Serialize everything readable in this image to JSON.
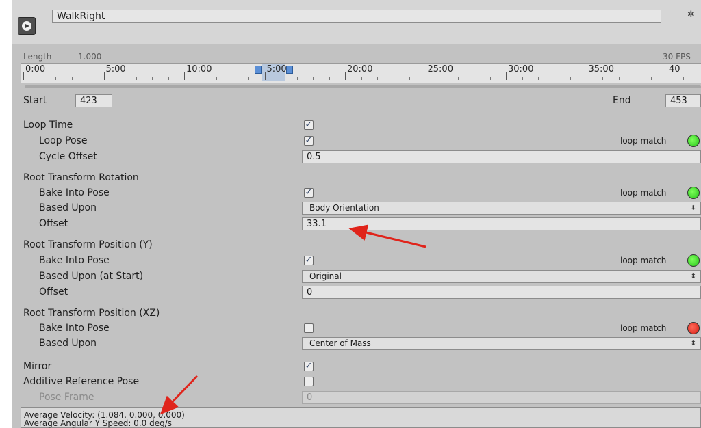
{
  "header": {
    "clip_name": "WalkRight",
    "play_icon": "play-icon",
    "settings_icon": "gear-icon"
  },
  "timeline": {
    "length_label": "Length",
    "length_value": "1.000",
    "fps": "30 FPS",
    "ticks": [
      "0:00",
      "5:00",
      "10:00",
      "5:00",
      "20:00",
      "25:00",
      "30:00",
      "35:00",
      "40"
    ]
  },
  "range": {
    "start_label": "Start",
    "start_value": "423",
    "end_label": "End",
    "end_value": "453"
  },
  "loop_time": {
    "label": "Loop Time",
    "checked": true,
    "loop_pose_label": "Loop Pose",
    "loop_pose_checked": true,
    "loop_match": "loop match",
    "cycle_offset_label": "Cycle Offset",
    "cycle_offset_value": "0.5"
  },
  "root_rotation": {
    "label": "Root Transform Rotation",
    "bake_label": "Bake Into Pose",
    "bake_checked": true,
    "loop_match": "loop match",
    "based_upon_label": "Based Upon",
    "based_upon_value": "Body Orientation",
    "offset_label": "Offset",
    "offset_value": "33.1"
  },
  "root_position_y": {
    "label": "Root Transform Position (Y)",
    "bake_label": "Bake Into Pose",
    "bake_checked": true,
    "loop_match": "loop match",
    "based_upon_label": "Based Upon (at Start)",
    "based_upon_value": "Original",
    "offset_label": "Offset",
    "offset_value": "0"
  },
  "root_position_xz": {
    "label": "Root Transform Position (XZ)",
    "bake_label": "Bake Into Pose",
    "bake_checked": false,
    "loop_match": "loop match",
    "based_upon_label": "Based Upon",
    "based_upon_value": "Center of Mass"
  },
  "mirror": {
    "label": "Mirror",
    "checked": true
  },
  "additive": {
    "label": "Additive Reference Pose",
    "checked": false,
    "pose_frame_label": "Pose Frame",
    "pose_frame_value": "0"
  },
  "info": {
    "velocity": "Average Velocity: (1.084, 0.000, 0.000)",
    "angular": "Average Angular Y Speed: 0.0 deg/s"
  },
  "colors": {
    "loop_ok": "#25c21a",
    "loop_bad": "#d41a10",
    "annotation_arrow": "#e0241b"
  }
}
